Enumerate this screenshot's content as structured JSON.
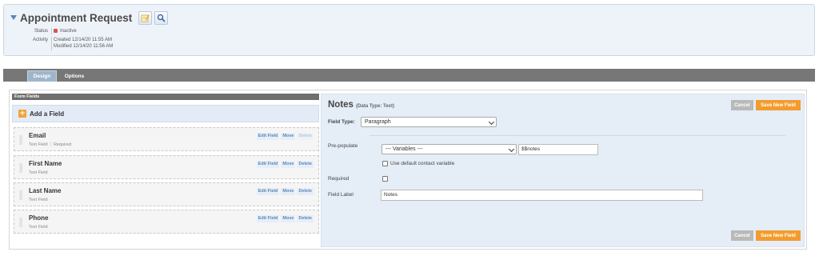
{
  "header": {
    "title": "Appointment Request",
    "status_label": "Status",
    "status_value": "Inactive",
    "activity_label": "Activity",
    "created": "Created 12/14/20 11:55 AM",
    "modified": "Modified 12/14/20 11:56 AM",
    "status_color": "#d9534f"
  },
  "tabs": [
    {
      "label": "Design",
      "active": true
    },
    {
      "label": "Options",
      "active": false
    }
  ],
  "form_fields": {
    "header": "Form Fields",
    "add_label": "Add a Field",
    "actions": {
      "edit": "Edit Field",
      "move": "Move",
      "delete": "Delete"
    },
    "fields": [
      {
        "name": "Email",
        "type": "Text Field",
        "required": "Required",
        "delete_disabled": true
      },
      {
        "name": "First Name",
        "type": "Text Field",
        "required": "",
        "delete_disabled": false
      },
      {
        "name": "Last Name",
        "type": "Text Field",
        "required": "",
        "delete_disabled": false
      },
      {
        "name": "Phone",
        "type": "Text Field",
        "required": "",
        "delete_disabled": false
      }
    ]
  },
  "editor": {
    "title": "Notes",
    "data_type": "(Data Type: Text)",
    "cancel_label": "Cancel",
    "save_label": "Save New Field",
    "field_type_label": "Field Type:",
    "field_type_value": "Paragraph",
    "prepopulate_label": "Pre-populate",
    "variables_value": "--- Variables ---",
    "prepopulate_value": "$$notes",
    "default_contact_label": "Use default contact variable",
    "required_label": "Required",
    "field_label_label": "Field Label",
    "field_label_value": "Notes"
  },
  "colors": {
    "accent_orange": "#f39c2d",
    "accent_blue": "#5d87b7",
    "panel_bg": "#e5edf7"
  }
}
